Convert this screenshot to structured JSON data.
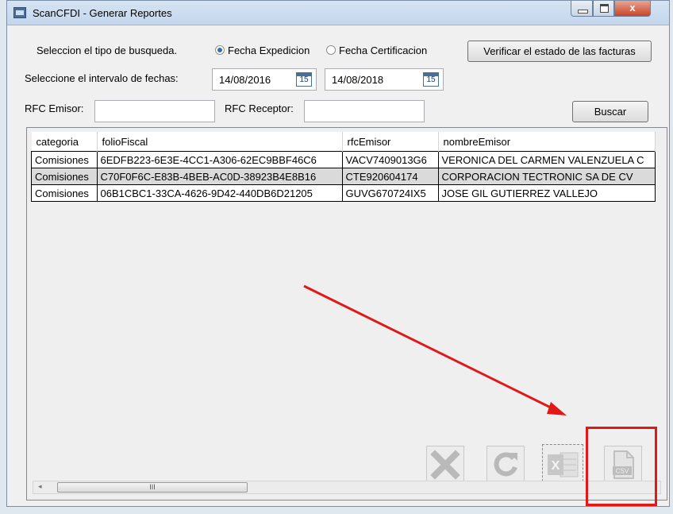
{
  "window": {
    "title": "ScanCFDI - Generar Reportes",
    "close_glyph": "x"
  },
  "search": {
    "type_label": "Seleccion el tipo de busqueda.",
    "option_expedicion": "Fecha Expedicion",
    "option_certificacion": "Fecha Certificacion",
    "selected_option": "Fecha Expedicion",
    "verify_button": "Verificar el estado de las facturas",
    "interval_label": "Seleccione el intervalo de fechas:",
    "date_from": "14/08/2016",
    "date_to": "14/08/2018",
    "calendar_icon_text": "15",
    "rfc_emisor_label": "RFC Emisor:",
    "rfc_emisor_value": "",
    "rfc_receptor_label": "RFC Receptor:",
    "rfc_receptor_value": "",
    "search_button": "Buscar"
  },
  "table": {
    "columns": [
      "categoria",
      "folioFiscal",
      "rfcEmisor",
      "nombreEmisor"
    ],
    "rows": [
      [
        "Comisiones",
        "6EDFB223-6E3E-4CC1-A306-62EC9BBF46C6",
        "VACV7409013G6",
        "VERONICA DEL CARMEN VALENZUELA C"
      ],
      [
        "Comisiones",
        "C70F0F6C-E83B-4BEB-AC0D-38923B4E8B16",
        "CTE920604174",
        "CORPORACION TECTRONIC SA DE CV"
      ],
      [
        "Comisiones",
        "06B1CBC1-33CA-4626-9D42-440DB6D21205",
        "GUVG670724IX5",
        "JOSE GIL GUTIERREZ VALLEJO"
      ]
    ]
  },
  "toolbar": {
    "buttons": [
      {
        "name": "delete",
        "icon": "close-x-icon"
      },
      {
        "name": "refresh",
        "icon": "refresh-icon"
      },
      {
        "name": "excel",
        "icon": "excel-icon",
        "label": "X"
      },
      {
        "name": "csv",
        "icon": "csv-file-icon",
        "label": "CSV"
      }
    ]
  },
  "scrollbar": {
    "thumb_glyph": "III"
  },
  "colors": {
    "annotation": "#e21818",
    "accent": "#3a6ea5"
  }
}
